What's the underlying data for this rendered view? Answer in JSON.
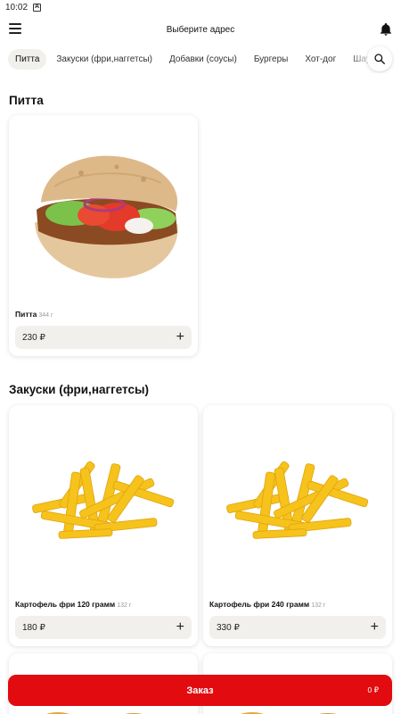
{
  "status_bar": {
    "time": "10:02",
    "notification_icon": "A"
  },
  "header": {
    "address": "Выберите адрес",
    "menu_icon": "hamburger-icon",
    "bell_icon": "bell-icon"
  },
  "tabs": [
    {
      "label": "Питта",
      "active": true
    },
    {
      "label": "Закуски (фри,наггетсы)",
      "active": false
    },
    {
      "label": "Добавки (соусы)",
      "active": false
    },
    {
      "label": "Бургеры",
      "active": false
    },
    {
      "label": "Хот-дог",
      "active": false
    },
    {
      "label": "Шаурма",
      "active": false
    }
  ],
  "sections": [
    {
      "title": "Питта",
      "items": [
        {
          "name": "Питта",
          "weight": "344 г",
          "price": "230 ₽"
        }
      ]
    },
    {
      "title": "Закуски (фри,наггетсы)",
      "items": [
        {
          "name": "Картофель фри 120 грамм",
          "weight": "132 г",
          "price": "180 ₽"
        },
        {
          "name": "Картофель фри 240 грамм",
          "weight": "132 г",
          "price": "330 ₽"
        }
      ]
    }
  ],
  "order": {
    "label": "Заказ",
    "total": "0 ₽"
  },
  "colors": {
    "accent": "#e10b10",
    "chip_bg": "#f2f0ed"
  }
}
